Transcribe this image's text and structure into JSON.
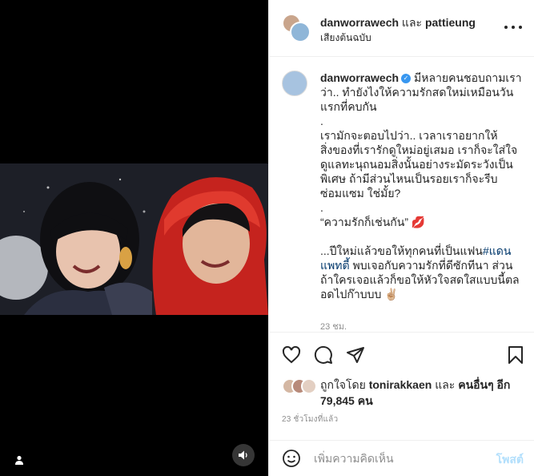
{
  "header": {
    "user1": "danworrawech",
    "and_word": "และ",
    "user2": "pattieung",
    "subtitle": "เสียงต้นฉบับ"
  },
  "caption": {
    "username": "danworrawech",
    "line1": "มีหลายคนชอบถามเราว่า.. ทำยังไงให้ความรักสดใหม่เหมือนวันแรกที่คบกัน\n.\nเรามักจะตอบไปว่า.. เวลาเราอยากให้สิ่งของที่เรารักดูใหม่อยู่เสมอ เราก็จะใส่ใจดูแลทะนุถนอมสิ่งนั้นอย่างระมัดระวังเป็นพิเศษ ถ้ามีส่วนไหนเป็นรอยเราก็จะรีบซ่อมแซม ใช่มั้ย?\n.\n“ความรักก็เช่นกัน” 💋\n\n...ปีใหม่แล้วขอให้ทุกคนที่เป็นแฟน",
    "hashtag": "#แดนแพทตี้",
    "line2": " พบเจอกับความรักที่ดีซักทีนา ส่วนถ้าใครเจอแล้วก็ขอให้หัวใจสดใสแบบนี้ตลอดไปก๊าบบบ ✌🏼",
    "time": "23 ชม."
  },
  "likes": {
    "prefix": "ถูกใจโดย",
    "user": "tonirakkaen",
    "and_word": "และ",
    "others": "คนอื่นๆ อีก 79,845 คน"
  },
  "post_time": "23 ชั่วโมงที่แล้ว",
  "comment": {
    "placeholder": "เพิ่มความคิดเห็น",
    "post_label": "โพสต์"
  },
  "colors": {
    "verified": "#3897f0",
    "post_disabled": "#b2dffc",
    "hashtag": "#00376b"
  },
  "icons": [
    "user-icon",
    "audio-icon",
    "heart-icon",
    "comment-icon",
    "share-icon",
    "bookmark-icon",
    "emoji-icon",
    "more-icon",
    "verified-icon"
  ]
}
